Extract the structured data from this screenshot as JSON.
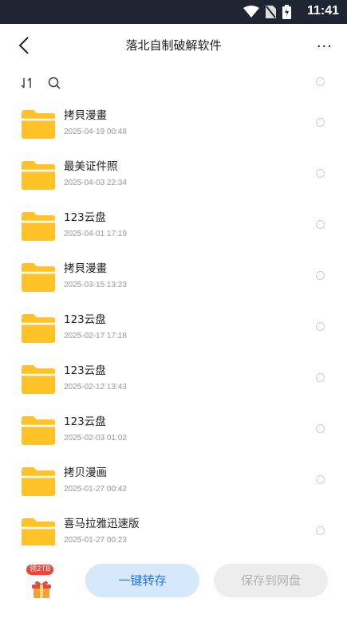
{
  "status_bar": {
    "time": "11:41"
  },
  "header": {
    "title": "落北自制破解软件",
    "more_label": "···"
  },
  "files": [
    {
      "name": "拷貝漫畫",
      "date": "2025-04-19 00:48"
    },
    {
      "name": "最美证件照",
      "date": "2025-04-03 22:34"
    },
    {
      "name": "123云盘",
      "date": "2025-04-01 17:19"
    },
    {
      "name": "拷貝漫畫",
      "date": "2025-03-15 13:23"
    },
    {
      "name": "123云盘",
      "date": "2025-02-17 17:18"
    },
    {
      "name": "123云盘",
      "date": "2025-02-12 13:43"
    },
    {
      "name": "123云盘",
      "date": "2025-02-03 01:02"
    },
    {
      "name": "拷贝漫画",
      "date": "2025-01-27 00:42"
    },
    {
      "name": "喜马拉雅迅速版",
      "date": "2025-01-27 00:23"
    }
  ],
  "bottom": {
    "gift_badge": "领2TB",
    "save_one_click": "一键转存",
    "save_to_drive": "保存到网盘"
  },
  "colors": {
    "statusbar": "#1f2533",
    "folder": "#ffc227",
    "primary": "#2477e0",
    "badge": "#e8483b"
  },
  "icons": [
    "wifi-icon",
    "no-sim-icon",
    "battery-icon",
    "back-icon",
    "more-icon",
    "sort-icon",
    "search-icon",
    "folder-icon",
    "gift-icon"
  ]
}
